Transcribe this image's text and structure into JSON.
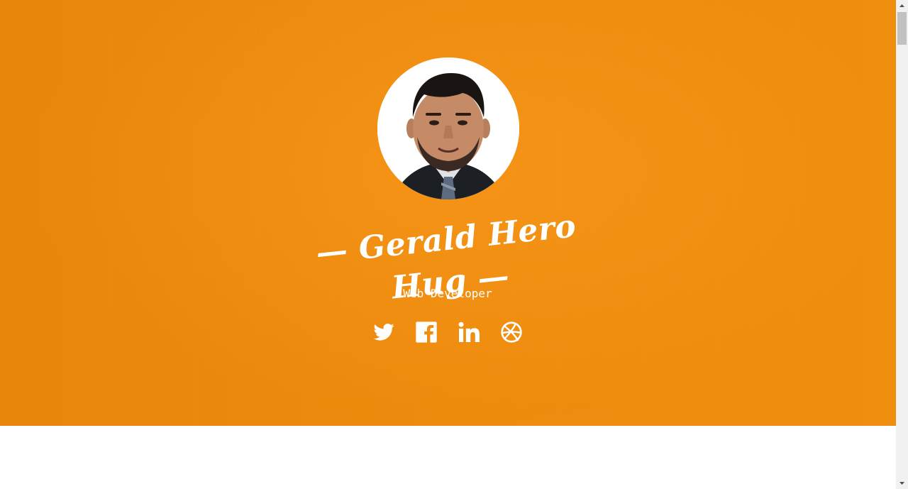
{
  "profile": {
    "name": "Gerald Hero Hug",
    "title": "Web Developer"
  },
  "social": [
    {
      "network": "Twitter",
      "icon": "twitter-icon"
    },
    {
      "network": "Facebook",
      "icon": "facebook-icon"
    },
    {
      "network": "LinkedIn",
      "icon": "linkedin-icon"
    },
    {
      "network": "Dribbble",
      "icon": "dribbble-icon"
    }
  ],
  "colors": {
    "hero_background": "#f48f0d",
    "text": "#ffffff",
    "page_background": "#ffffff"
  }
}
